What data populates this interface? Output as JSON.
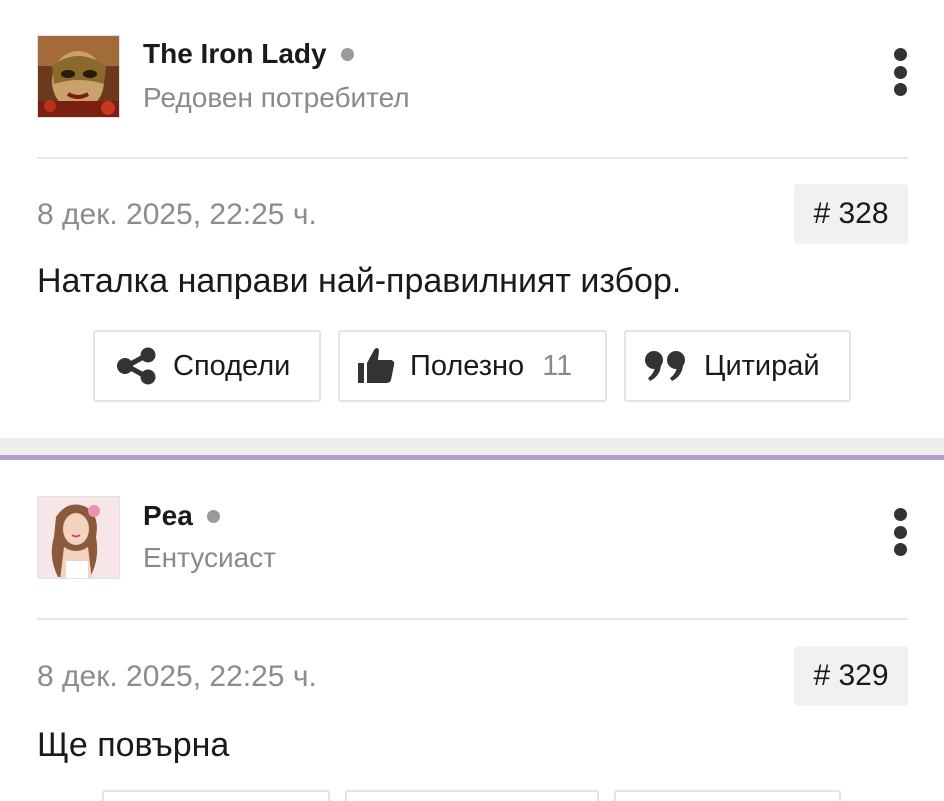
{
  "posts": [
    {
      "author": "The Iron Lady",
      "rank": "Редовен потребител",
      "date": "8 дек. 2025, 22:25 ч.",
      "number": "# 328",
      "message": "Наталка направи най-правилният избор.",
      "actions": {
        "share_label": "Сподели",
        "like_label": "Полезно",
        "like_count": "11",
        "quote_label": "Цитирай"
      }
    },
    {
      "author": "Pea",
      "rank": "Ентусиаст",
      "date": "8 дек. 2025, 22:25 ч.",
      "number": "# 329",
      "message": "Ще повърна"
    }
  ],
  "icons": {
    "share": "share-icon",
    "like": "thumbs-up-icon",
    "quote": "quote-icon",
    "menu": "kebab-menu-icon",
    "online": "online-status-icon"
  },
  "colors": {
    "separator_accent": "#b79cc9",
    "muted_text": "#8a8a8a",
    "online_dot": "#9a9a9a"
  }
}
